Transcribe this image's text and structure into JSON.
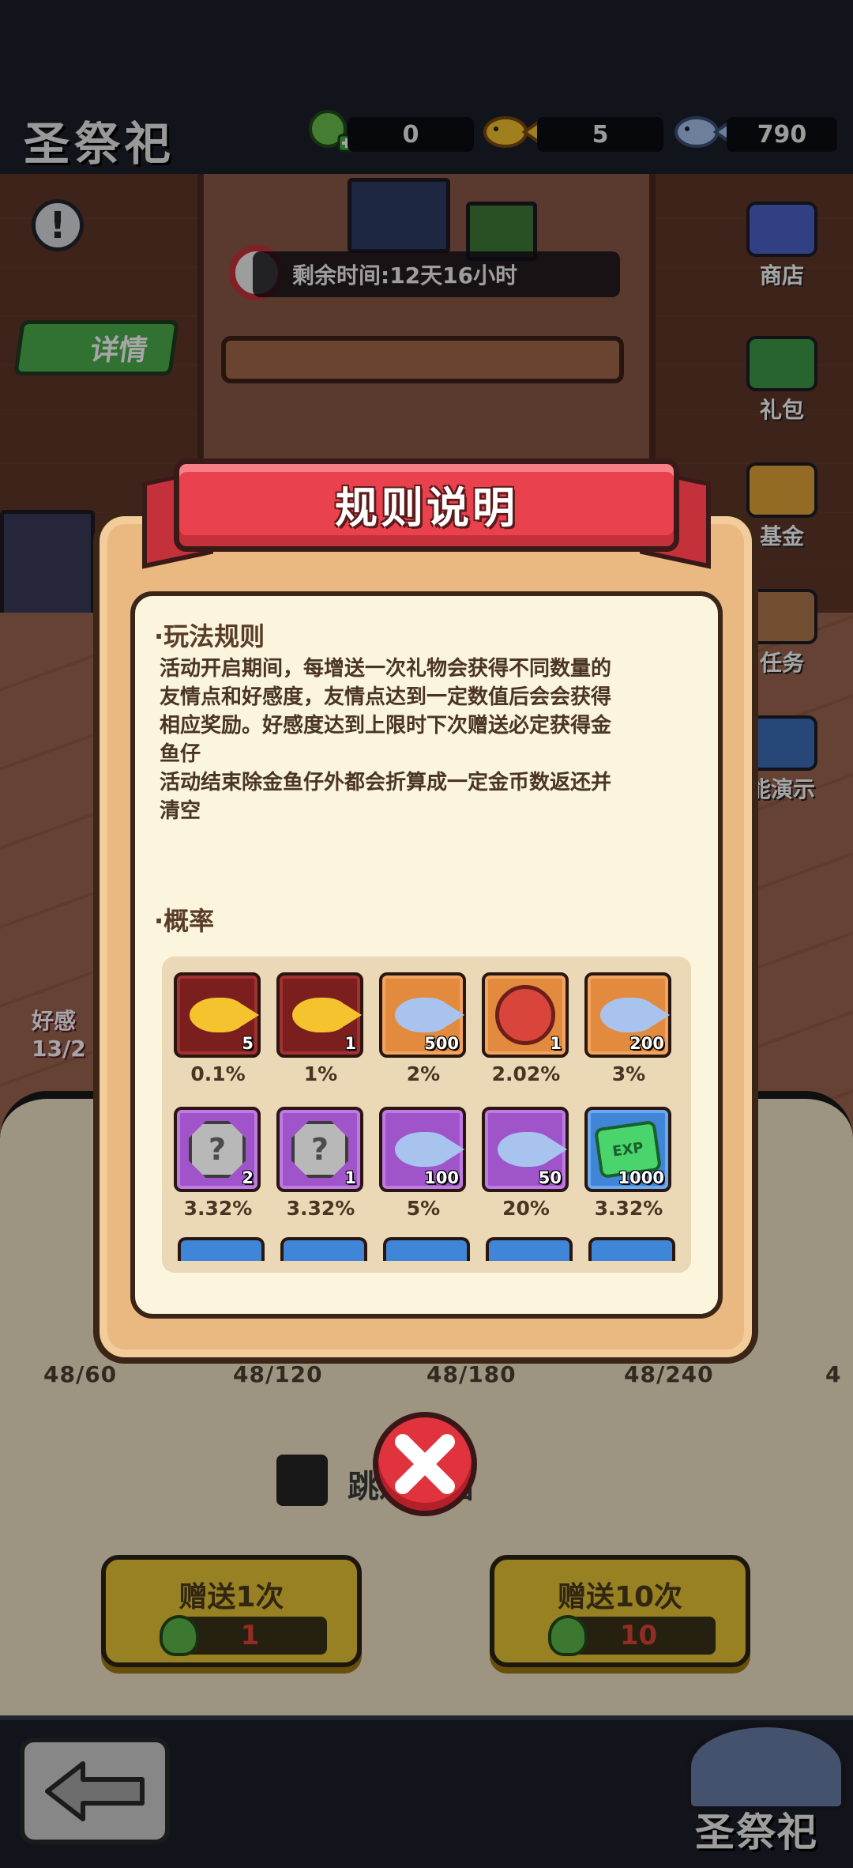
{
  "header": {
    "title": "圣祭祀",
    "currencies": [
      {
        "icon": "green-gem-plus-icon",
        "value": "0"
      },
      {
        "icon": "gold-fish-icon",
        "value": "5"
      },
      {
        "icon": "silver-fish-icon",
        "value": "790"
      }
    ]
  },
  "timer": {
    "text": "剩余时间:12天16小时"
  },
  "detail_button": {
    "label": "详情"
  },
  "side_menu": [
    {
      "label": "商店",
      "icon": "shop-icon"
    },
    {
      "label": "礼包",
      "icon": "gift-icon"
    },
    {
      "label": "基金",
      "icon": "safe-icon"
    },
    {
      "label": "任务",
      "icon": "clipboard-icon"
    },
    {
      "label": "能演示",
      "icon": "video-icon"
    }
  ],
  "affection_partial": {
    "label": "好感",
    "value": "13/2"
  },
  "dialog": {
    "title": "规则说明",
    "rules_heading": "·玩法规则",
    "rules_text": "活动开启期间，每增送一次礼物会获得不同数量的\n友情点和好感度，友情点达到一定数值后会会获得\n相应奖励。好感度达到上限时下次赠送必定获得金\n鱼仔\n活动结束除金鱼仔外都会折算成一定金币数返还并\n清空",
    "prob_heading": "·概率",
    "items": [
      {
        "icon": "gold-fish-icon",
        "qty": "5",
        "pct": "0.1%",
        "color": "red"
      },
      {
        "icon": "gold-fish-icon",
        "qty": "1",
        "pct": "1%",
        "color": "red"
      },
      {
        "icon": "silver-fish-icon",
        "qty": "500",
        "pct": "2%",
        "color": "orange"
      },
      {
        "icon": "red-seal-icon",
        "qty": "1",
        "pct": "2.02%",
        "color": "orange"
      },
      {
        "icon": "silver-fish-icon",
        "qty": "200",
        "pct": "3%",
        "color": "orange"
      },
      {
        "icon": "mystery-stone-icon",
        "qty": "2",
        "pct": "3.32%",
        "color": "purple"
      },
      {
        "icon": "mystery-stone-icon",
        "qty": "1",
        "pct": "3.32%",
        "color": "purple"
      },
      {
        "icon": "silver-fish-icon",
        "qty": "100",
        "pct": "5%",
        "color": "purple"
      },
      {
        "icon": "silver-fish-icon",
        "qty": "50",
        "pct": "20%",
        "color": "purple"
      },
      {
        "icon": "exp-gem-icon",
        "qty": "1000",
        "pct": "3.32%",
        "color": "blue"
      }
    ],
    "exp_label": "EXP",
    "stone_mark": "?"
  },
  "progress": [
    "48/60",
    "48/120",
    "48/180",
    "48/240",
    "4"
  ],
  "skip_animation": {
    "label": "跳过动画"
  },
  "give_buttons": [
    {
      "label": "赠送1次",
      "cost": "1"
    },
    {
      "label": "赠送10次",
      "cost": "10"
    }
  ],
  "footer": {
    "title": "圣祭祀"
  },
  "colors": {
    "ribbon": "#e9424e",
    "dialog": "#e9b981",
    "panel": "#fbf5dd",
    "give": "#e9c635"
  }
}
